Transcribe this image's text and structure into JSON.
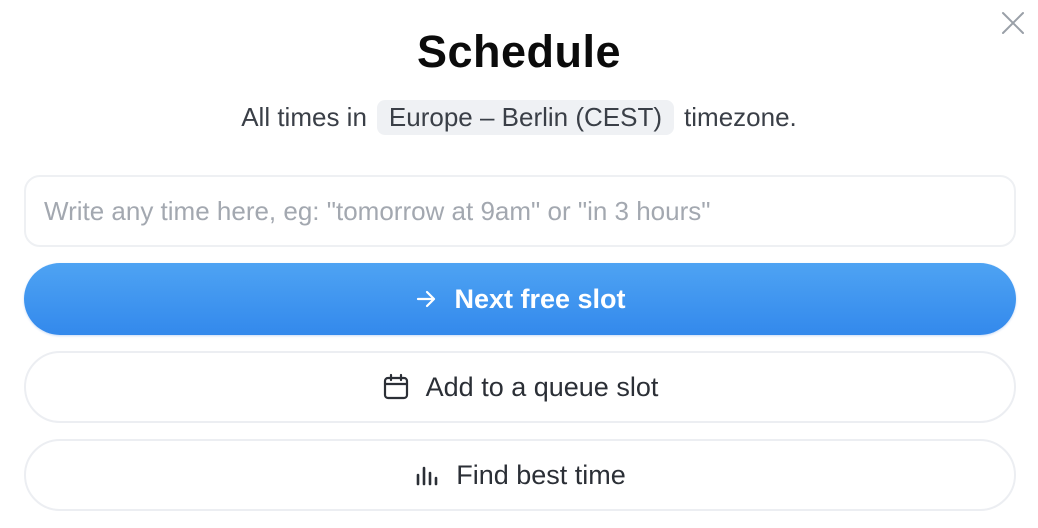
{
  "dialog": {
    "title": "Schedule",
    "close_icon": "close-icon"
  },
  "timezone": {
    "prefix": "All times in",
    "value": "Europe – Berlin (CEST)",
    "suffix": "timezone."
  },
  "time_input": {
    "value": "",
    "placeholder": "Write any time here, eg: \"tomorrow at 9am\" or \"in 3 hours\""
  },
  "actions": {
    "next_free_slot": {
      "label": "Next free slot",
      "icon": "arrow-right-icon"
    },
    "queue_slot": {
      "label": "Add to a queue slot",
      "icon": "calendar-icon"
    },
    "best_time": {
      "label": "Find best time",
      "icon": "bar-chart-icon"
    }
  },
  "colors": {
    "primary": "#3d95f0",
    "chip_bg": "#eff1f4",
    "border": "#eceef2"
  }
}
